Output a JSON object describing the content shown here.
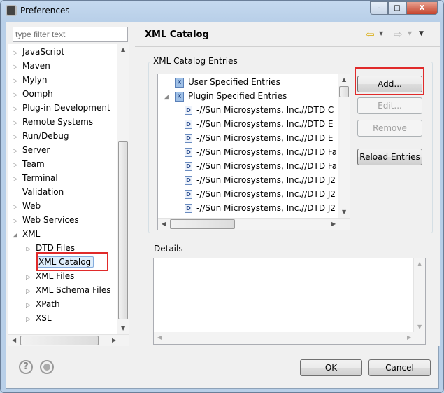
{
  "window": {
    "title": "Preferences",
    "minimize": "–",
    "maximize": "□",
    "close": "X"
  },
  "sidebar": {
    "filter_placeholder": "type filter text",
    "items": [
      {
        "label": "JavaScript",
        "level": 0,
        "exp": "closed"
      },
      {
        "label": "Maven",
        "level": 0,
        "exp": "closed"
      },
      {
        "label": "Mylyn",
        "level": 0,
        "exp": "closed"
      },
      {
        "label": "Oomph",
        "level": 0,
        "exp": "closed"
      },
      {
        "label": "Plug-in Development",
        "level": 0,
        "exp": "closed"
      },
      {
        "label": "Remote Systems",
        "level": 0,
        "exp": "closed"
      },
      {
        "label": "Run/Debug",
        "level": 0,
        "exp": "closed"
      },
      {
        "label": "Server",
        "level": 0,
        "exp": "closed"
      },
      {
        "label": "Team",
        "level": 0,
        "exp": "closed"
      },
      {
        "label": "Terminal",
        "level": 0,
        "exp": "closed"
      },
      {
        "label": "Validation",
        "level": 0,
        "exp": "none"
      },
      {
        "label": "Web",
        "level": 0,
        "exp": "closed"
      },
      {
        "label": "Web Services",
        "level": 0,
        "exp": "closed"
      },
      {
        "label": "XML",
        "level": 0,
        "exp": "open"
      },
      {
        "label": "DTD Files",
        "level": 1,
        "exp": "closed"
      },
      {
        "label": "XML Catalog",
        "level": 1,
        "exp": "none",
        "selected": true
      },
      {
        "label": "XML Files",
        "level": 1,
        "exp": "closed"
      },
      {
        "label": "XML Schema Files",
        "level": 1,
        "exp": "closed"
      },
      {
        "label": "XPath",
        "level": 1,
        "exp": "closed"
      },
      {
        "label": "XSL",
        "level": 1,
        "exp": "closed"
      }
    ]
  },
  "page": {
    "title": "XML Catalog",
    "entries_group": "XML Catalog Entries",
    "entries": [
      {
        "label": "User Specified Entries",
        "type": "catalog",
        "level": 0,
        "exp": "none"
      },
      {
        "label": "Plugin Specified Entries",
        "type": "catalog",
        "level": 0,
        "exp": "open"
      },
      {
        "label": "-//Sun Microsystems, Inc.//DTD C",
        "type": "dtd",
        "level": 1
      },
      {
        "label": "-//Sun Microsystems, Inc.//DTD E",
        "type": "dtd",
        "level": 1
      },
      {
        "label": "-//Sun Microsystems, Inc.//DTD E",
        "type": "dtd",
        "level": 1
      },
      {
        "label": "-//Sun Microsystems, Inc.//DTD Fa",
        "type": "dtd",
        "level": 1
      },
      {
        "label": "-//Sun Microsystems, Inc.//DTD Fa",
        "type": "dtd",
        "level": 1
      },
      {
        "label": "-//Sun Microsystems, Inc.//DTD J2",
        "type": "dtd",
        "level": 1
      },
      {
        "label": "-//Sun Microsystems, Inc.//DTD J2",
        "type": "dtd",
        "level": 1
      },
      {
        "label": "-//Sun Microsystems, Inc.//DTD J2",
        "type": "dtd",
        "level": 1
      }
    ],
    "buttons": {
      "add": "Add...",
      "edit": "Edit...",
      "remove": "Remove",
      "reload": "Reload Entries"
    },
    "details_label": "Details"
  },
  "footer": {
    "ok": "OK",
    "cancel": "Cancel",
    "help_icon": "?"
  },
  "colors": {
    "highlight": "#e02a2a",
    "selection": "#dfeefb"
  }
}
